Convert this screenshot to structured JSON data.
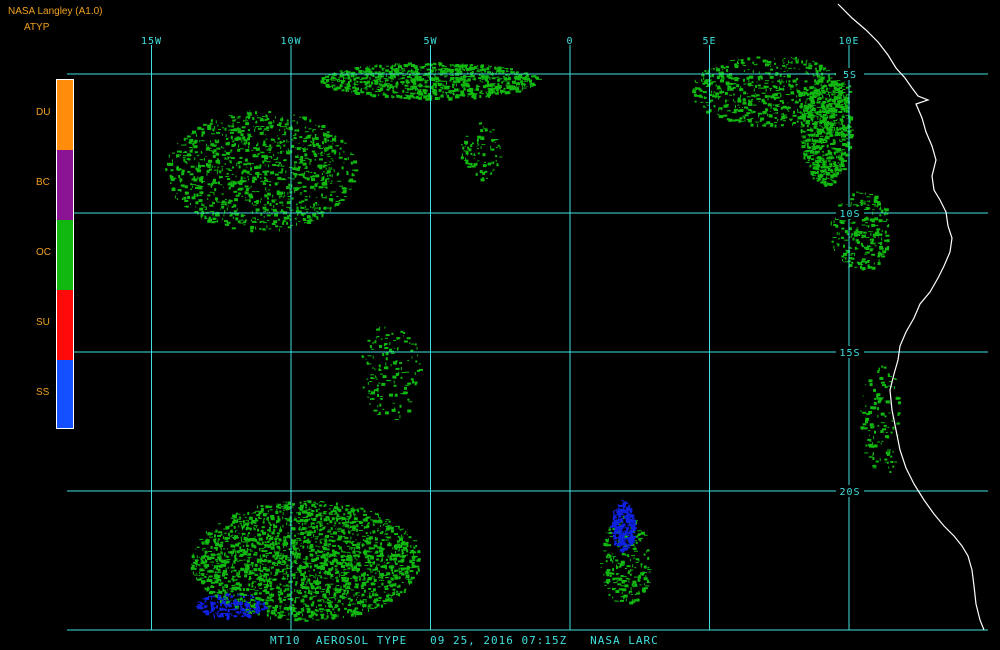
{
  "header": {
    "title": "NASA Langley (A1.0)",
    "product": "ATYP"
  },
  "legend": {
    "categories": [
      {
        "code": "DU",
        "color": "#ff8c0a"
      },
      {
        "code": "BC",
        "color": "#8a1493"
      },
      {
        "code": "OC",
        "color": "#10b810"
      },
      {
        "code": "SU",
        "color": "#ff0a0a"
      },
      {
        "code": "SS",
        "color": "#1450ff"
      }
    ]
  },
  "grid": {
    "color": "#40e0e0",
    "longitudes": [
      {
        "label": "15W",
        "lon": -15
      },
      {
        "label": "10W",
        "lon": -10
      },
      {
        "label": "5W",
        "lon": -5
      },
      {
        "label": "0",
        "lon": 0
      },
      {
        "label": "5E",
        "lon": 5
      },
      {
        "label": "10E",
        "lon": 10
      }
    ],
    "latitudes": [
      {
        "label": "5S",
        "lat": -5
      },
      {
        "label": "10S",
        "lat": -10
      },
      {
        "label": "15S",
        "lat": -15
      },
      {
        "label": "20S",
        "lat": -20
      }
    ]
  },
  "footer": {
    "text": "MT10  AEROSOL TYPE   09 25, 2016 07:15Z   NASA LARC"
  },
  "colors": {
    "background": "#000000",
    "coastline": "#ffffff",
    "oc": "#10b810",
    "ss": "#1020e0"
  }
}
